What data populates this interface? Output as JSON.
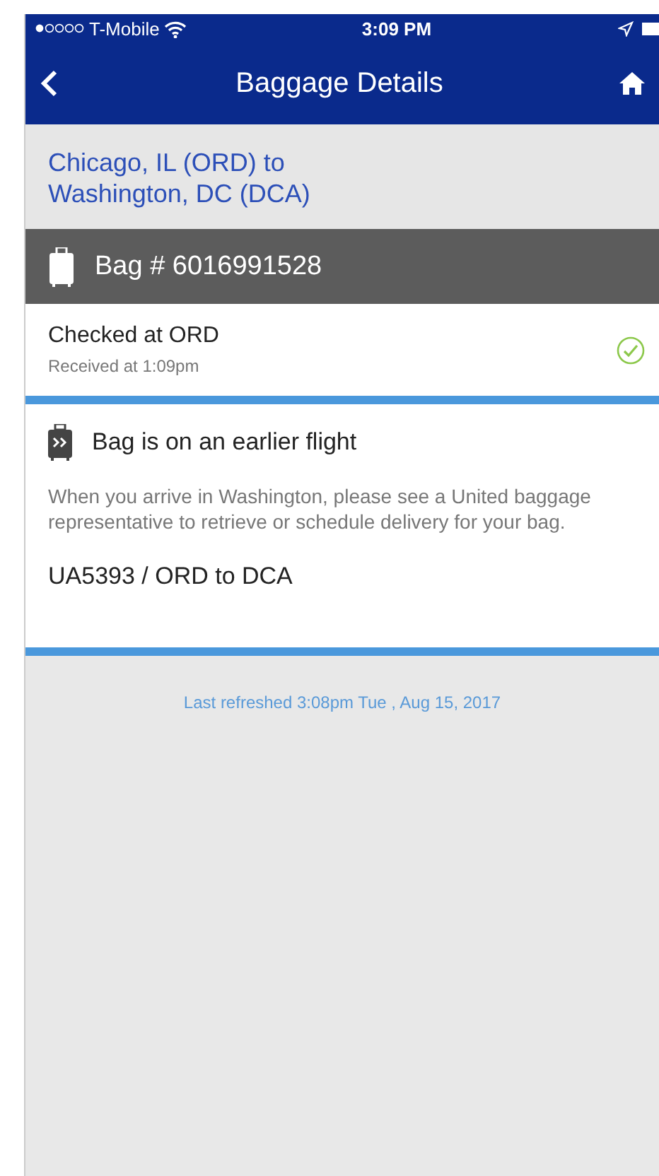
{
  "status_bar": {
    "carrier": "T-Mobile",
    "time": "3:09 PM"
  },
  "nav": {
    "title": "Baggage Details"
  },
  "route": "Chicago, IL (ORD) to\nWashington, DC (DCA)",
  "bag": {
    "label": "Bag # 6016991528",
    "events": [
      {
        "title": "Checked at ORD",
        "detail": "Received at 1:09pm",
        "done": true
      }
    ],
    "notice": {
      "title": "Bag is on an earlier flight",
      "body": "When you arrive in Washington, please see a United baggage representative to retrieve or schedule delivery for your bag.",
      "flight": "UA5393 / ORD to DCA"
    }
  },
  "footer": "Last refreshed 3:08pm Tue , Aug 15, 2017"
}
